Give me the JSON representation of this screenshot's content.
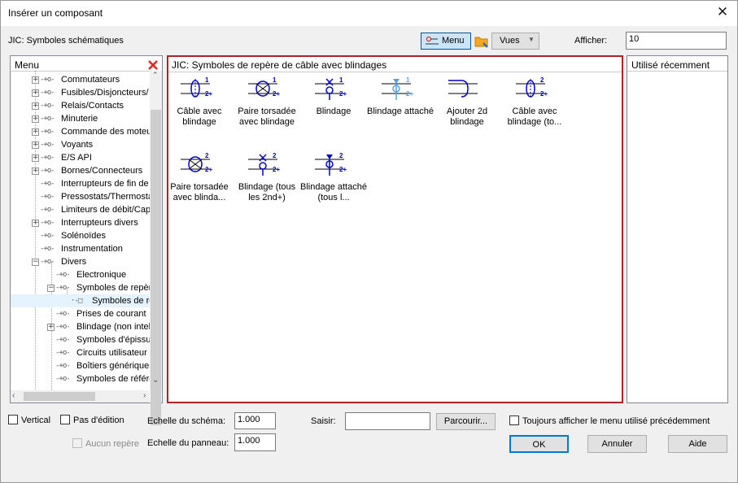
{
  "window": {
    "title": "Insérer un composant"
  },
  "toolbar": {
    "category_label": "JIC: Symboles schématiques",
    "menu_button": "Menu",
    "views_button": "Vues",
    "show_label": "Afficher:",
    "show_value": "10"
  },
  "left_panel": {
    "title": "Menu",
    "items": [
      {
        "label": "Commutateurs"
      },
      {
        "label": "Fusibles/Disjoncteurs/"
      },
      {
        "label": "Relais/Contacts"
      },
      {
        "label": "Minuterie"
      },
      {
        "label": "Commande des moteur"
      },
      {
        "label": "Voyants"
      },
      {
        "label": "E/S API"
      },
      {
        "label": "Bornes/Connecteurs"
      },
      {
        "label": "Interrupteurs de fin de c"
      },
      {
        "label": "Pressostats/Thermosta"
      },
      {
        "label": "Limiteurs de débit/Capt"
      },
      {
        "label": "Interrupteurs divers"
      },
      {
        "label": "Solénoïdes"
      },
      {
        "label": "Instrumentation"
      },
      {
        "label": "Divers"
      },
      {
        "label": "Electronique"
      },
      {
        "label": "Symboles de repère"
      },
      {
        "label": "Symboles de re"
      },
      {
        "label": "Prises de courant"
      },
      {
        "label": "Blindage (non intell"
      },
      {
        "label": "Symboles d'épissur"
      },
      {
        "label": "Circuits utilisateur"
      },
      {
        "label": "Boîtiers génériques"
      },
      {
        "label": "Symboles de référe"
      }
    ]
  },
  "center_panel": {
    "title": "JIC: Symboles de repère de câble avec blindages",
    "symbols": [
      {
        "label": "Câble avec blindage",
        "n1": "1",
        "n2": "2+"
      },
      {
        "label": "Paire torsadée avec blindage",
        "n1": "1",
        "n2": "2+"
      },
      {
        "label": "Blindage",
        "n1": "1",
        "n2": "2+"
      },
      {
        "label": "Blindage attaché",
        "n1": "1",
        "n2": "2+"
      },
      {
        "label": "Ajouter 2d blindage",
        "n1": "",
        "n2": ""
      },
      {
        "label": "Câble avec blindage (to...",
        "n1": "2",
        "n2": "2+"
      },
      {
        "label": "Paire torsadée avec blinda...",
        "n1": "2",
        "n2": "2+"
      },
      {
        "label": "Blindage (tous les 2nd+)",
        "n1": "2",
        "n2": "2+"
      },
      {
        "label": "Blindage attaché (tous l...",
        "n1": "2",
        "n2": "2+"
      }
    ]
  },
  "right_panel": {
    "title": "Utilisé récemment"
  },
  "bottom": {
    "vertical_label": "Vertical",
    "no_edit_label": "Pas d'édition",
    "no_marker_label": "Aucun repère",
    "schema_scale_label": "Echelle du schéma:",
    "schema_scale_value": "1.000",
    "panel_scale_label": "Echelle du panneau:",
    "panel_scale_value": "1.000",
    "input_label": "Saisir:",
    "input_value": "",
    "browse_button": "Parcourir...",
    "always_show_label": "Toujours afficher le menu utilisé précédemment",
    "ok_button": "OK",
    "cancel_button": "Annuler",
    "help_button": "Aide"
  },
  "colors": {
    "accent": "#0000cc",
    "highlight_border": "#b22222",
    "close_red": "#e0261c"
  }
}
